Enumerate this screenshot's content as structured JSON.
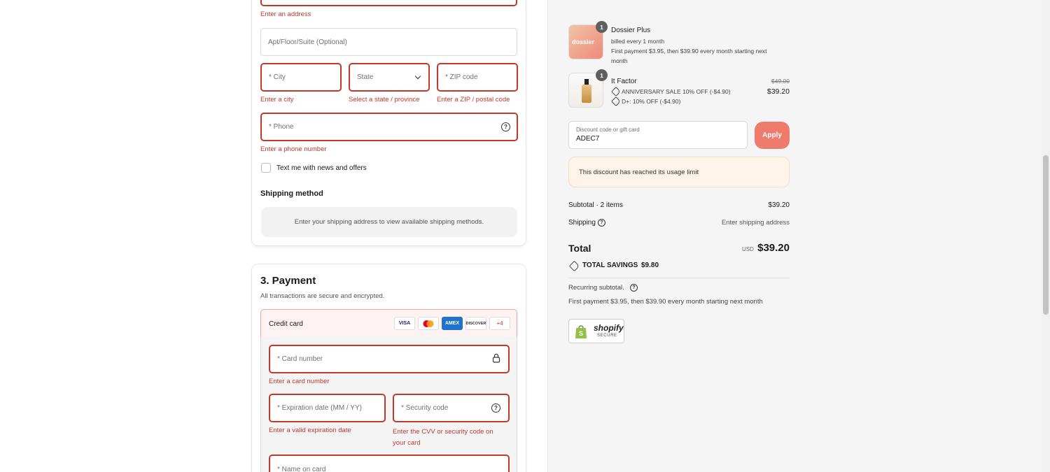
{
  "address": {
    "address_error": "Enter an address",
    "apt_placeholder": "Apt/Floor/Suite (Optional)",
    "city_placeholder": "* City",
    "city_error": "Enter a city",
    "state_placeholder": "State",
    "state_error": "Select a state / province",
    "zip_placeholder": "* ZIP code",
    "zip_error": "Enter a ZIP / postal code",
    "phone_placeholder": "* Phone",
    "phone_error": "Enter a phone number",
    "text_me_label": "Text me with news and offers"
  },
  "shipping": {
    "heading": "Shipping method",
    "message": "Enter your shipping address to view available shipping methods."
  },
  "payment": {
    "heading": "3. Payment",
    "subheading": "All transactions are secure and encrypted.",
    "method_label": "Credit card",
    "cards": [
      "VISA",
      "MC",
      "AMEX",
      "DISCOVER"
    ],
    "more_cards": "+4",
    "card_number_placeholder": "* Card number",
    "card_number_error": "Enter a card number",
    "expiry_placeholder": "* Expiration date (MM / YY)",
    "expiry_error": "Enter a valid expiration date",
    "cvv_placeholder": "* Security code",
    "cvv_error": "Enter the CVV or security code on your card",
    "name_placeholder": "* Name on card"
  },
  "order": {
    "items": [
      {
        "qty": "1",
        "thumb_text": "dossier",
        "name": "Dossier Plus",
        "line1": "billed every 1 month",
        "line2": "First payment $3.95, then $39.90 every month starting next",
        "line3": "month"
      },
      {
        "qty": "1",
        "name": "It Factor",
        "discount1": "ANNIVERSARY SALE 10% OFF (-$4.90)",
        "discount2": "D+: 10% OFF (-$4.90)",
        "original_price": "$49.00",
        "price": "$39.20"
      }
    ],
    "discount_label": "Discount code or gift card",
    "discount_value": "ADEC7",
    "apply_label": "Apply",
    "discount_notice": "This discount has reached its usage limit",
    "subtotal_label": "Subtotal · 2 items",
    "subtotal_value": "$39.20",
    "shipping_label": "Shipping",
    "shipping_value": "Enter shipping address",
    "total_label": "Total",
    "total_currency": "USD",
    "total_value": "$39.20",
    "savings_label": "TOTAL SAVINGS",
    "savings_value": "$9.80",
    "recurring_label": "Recurring subtotal.",
    "recurring_text": "First payment $3.95, then $39.90 every month starting next month",
    "shopify_brand": "shopify",
    "shopify_secure": "SECURE"
  },
  "colors": {
    "error": "#c0392b",
    "apply": "#ee7b6c",
    "notice_bg": "#fff4ea"
  }
}
